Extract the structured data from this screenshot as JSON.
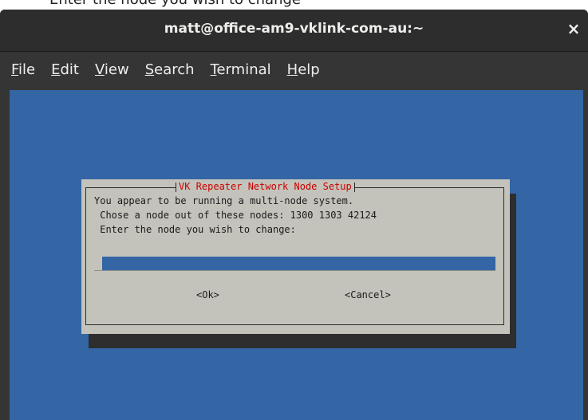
{
  "top_caption": "Enter the node you wish to change",
  "window": {
    "title": "matt@office-am9-vklink-com-au:~",
    "close_symbol": "×"
  },
  "menubar": {
    "items": [
      {
        "accel": "F",
        "rest": "ile"
      },
      {
        "accel": "E",
        "rest": "dit"
      },
      {
        "accel": "V",
        "rest": "iew"
      },
      {
        "accel": "S",
        "rest": "earch"
      },
      {
        "accel": "T",
        "rest": "erminal"
      },
      {
        "accel": "H",
        "rest": "elp"
      }
    ]
  },
  "dialog": {
    "title": "VK Repeater Network Node Setup",
    "lines": [
      "You appear to be running a multi-node system.",
      " Chose a node out of these nodes: 1300 1303 42124",
      " Enter the node you wish to change:"
    ],
    "input_value": "",
    "ok_label": "<Ok>",
    "cancel_label": "<Cancel>"
  },
  "colors": {
    "terminal_bg": "#3465a4",
    "dialog_bg": "#c3c3bb",
    "title_red": "#cc0000",
    "window_chrome": "#2d2d2d"
  }
}
